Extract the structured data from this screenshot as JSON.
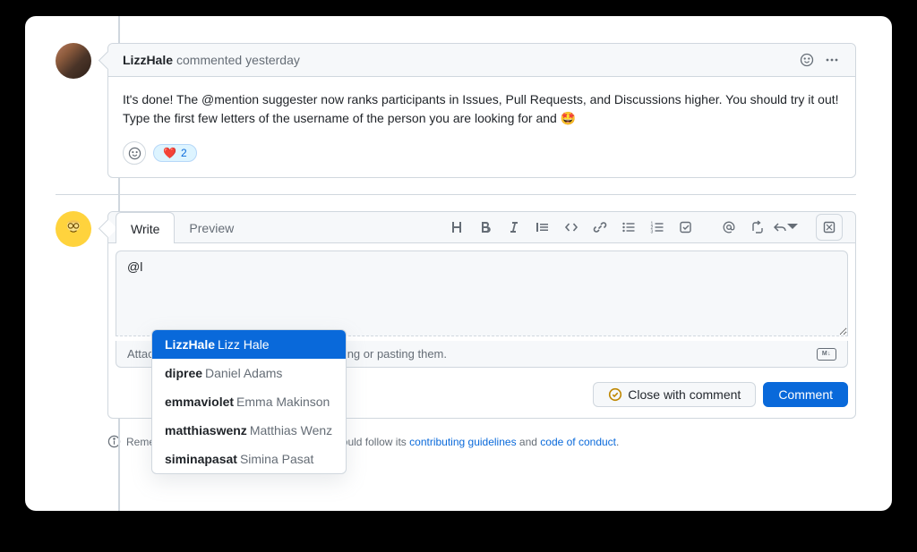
{
  "comment": {
    "author": "LizzHale",
    "action": "commented",
    "time": "yesterday",
    "body": "It's done! The @mention suggester now ranks participants in Issues, Pull Requests, and Discussions higher. You should try it out! Type the first few letters of the username of the person you are looking for and 🤩",
    "reaction_emoji": "❤️",
    "reaction_count": "2"
  },
  "composer": {
    "tabs": {
      "write": "Write",
      "preview": "Preview"
    },
    "value": "@l",
    "attach_hint": "Attach files by dragging & dropping, selecting or pasting them.",
    "close_label": "Close with comment",
    "submit_label": "Comment"
  },
  "suggestions": [
    {
      "username": "LizzHale",
      "realname": "Lizz Hale"
    },
    {
      "username": "dipree",
      "realname": "Daniel Adams"
    },
    {
      "username": "emmaviolet",
      "realname": "Emma Makinson"
    },
    {
      "username": "matthiaswenz",
      "realname": "Matthias Wenz"
    },
    {
      "username": "siminapasat",
      "realname": "Simina Pasat"
    }
  ],
  "guidelines": {
    "prefix": "Remember, contributions to this repository should follow its ",
    "link1": "contributing guidelines",
    "middle": " and ",
    "link2": "code of conduct",
    "suffix": "."
  }
}
